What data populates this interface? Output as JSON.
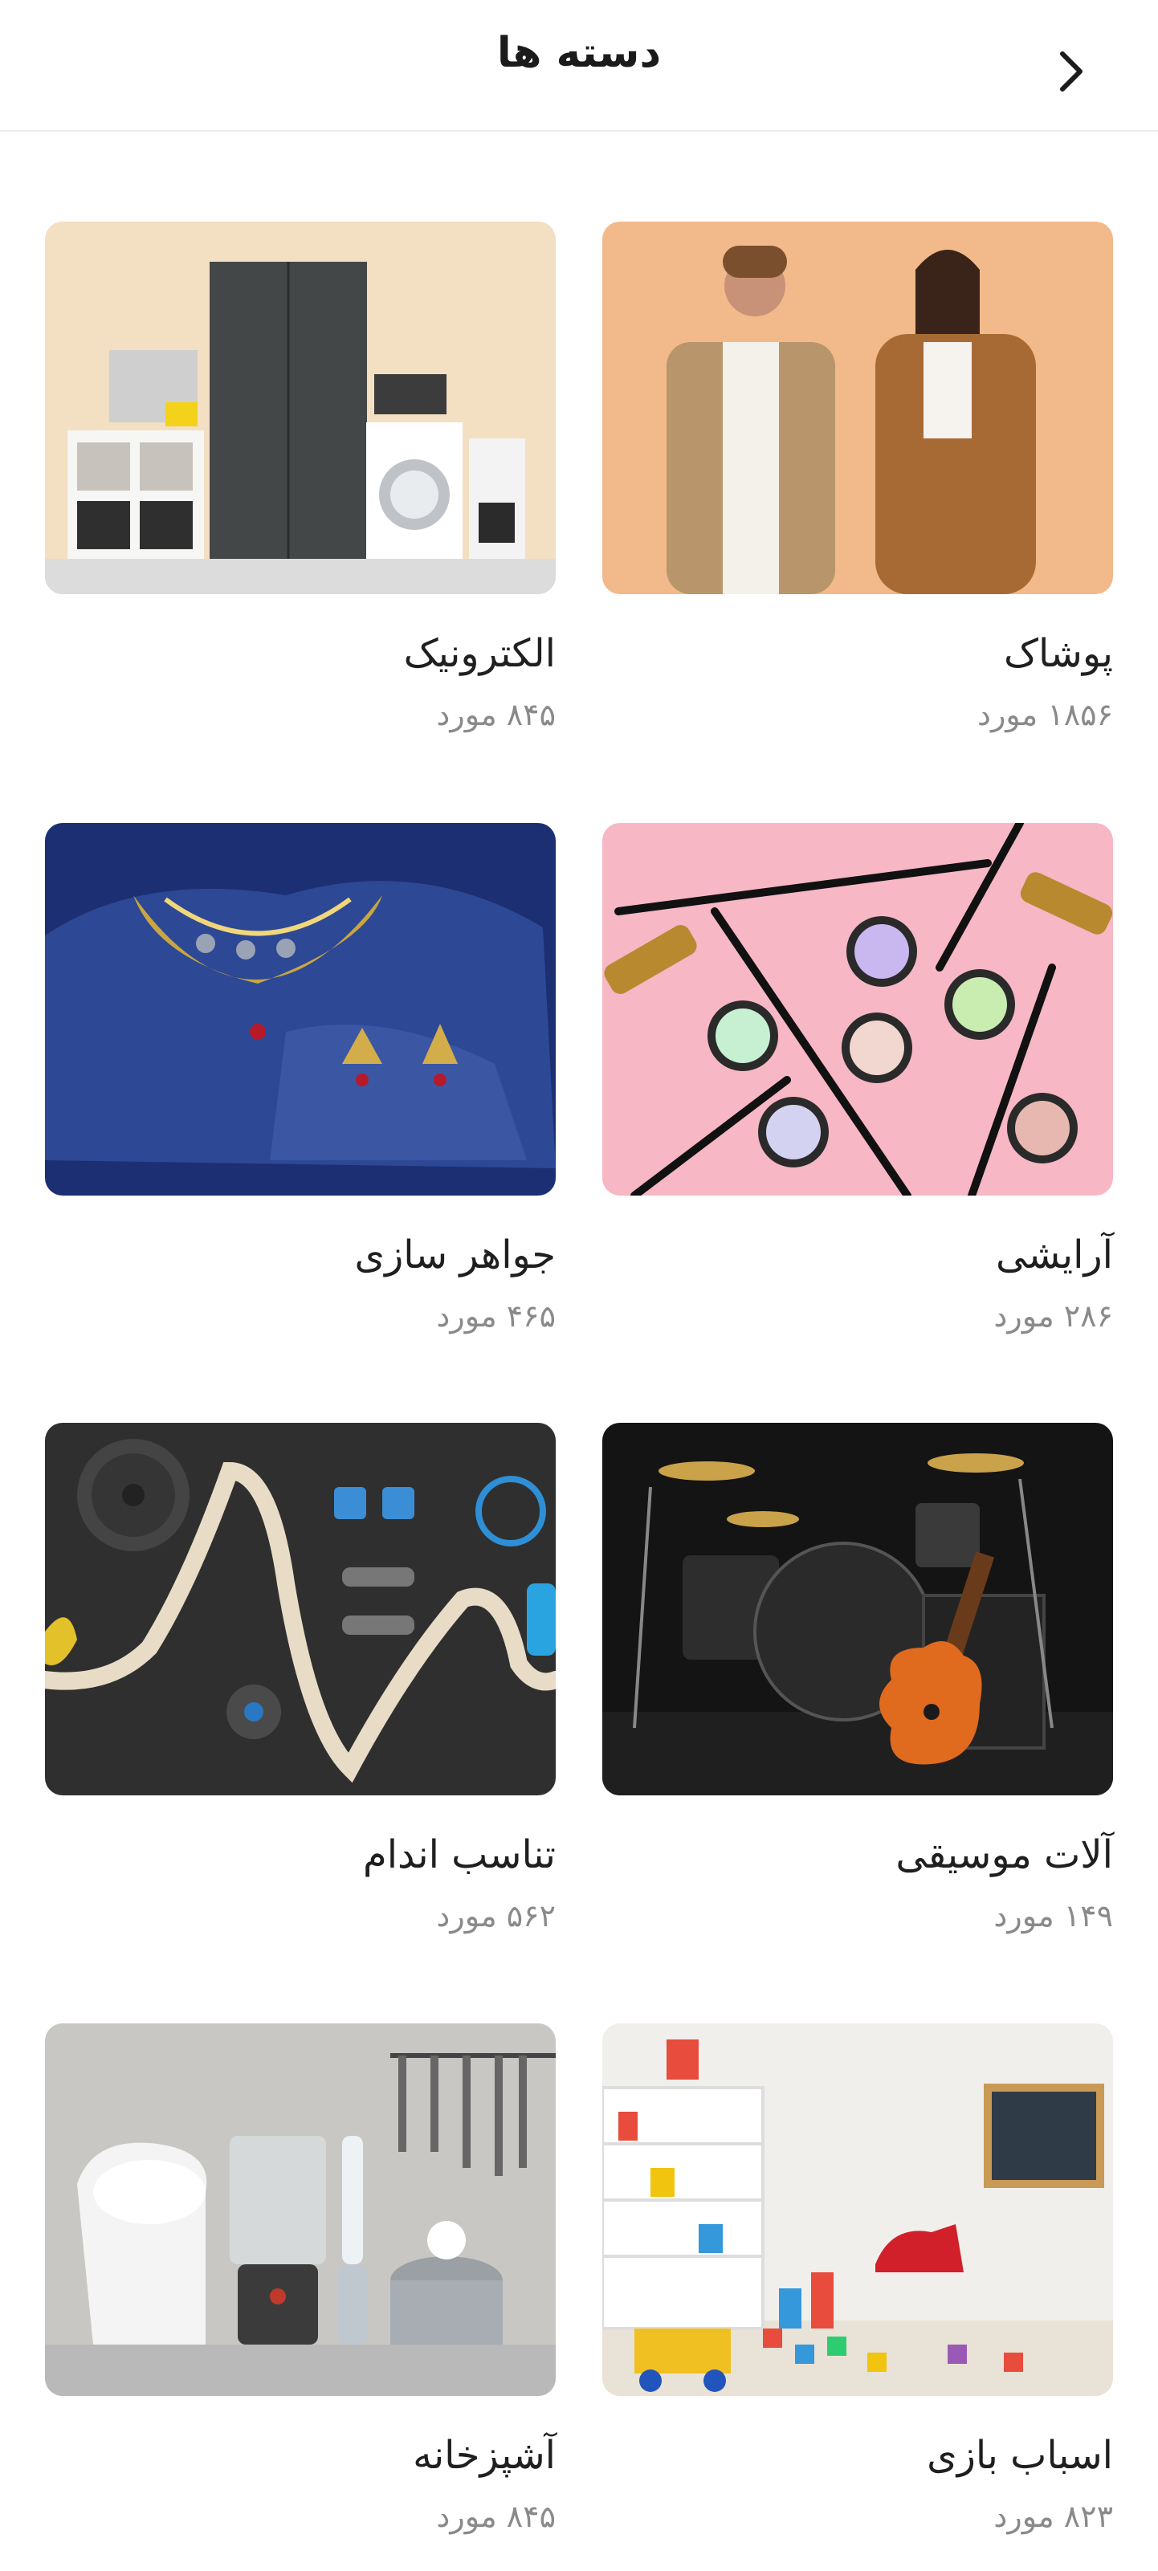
{
  "header": {
    "title": "دسته ها",
    "back_icon": "chevron-right-icon"
  },
  "categories": [
    {
      "label": "پوشاک",
      "count": "۱۸۵۶ مورد",
      "icon": "clothing-image"
    },
    {
      "label": "الکترونیک",
      "count": "۸۴۵ مورد",
      "icon": "electronics-image"
    },
    {
      "label": "آرایشی",
      "count": "۲۸۶ مورد",
      "icon": "cosmetics-image"
    },
    {
      "label": "جواهر سازی",
      "count": "۴۶۵ مورد",
      "icon": "jewelry-image"
    },
    {
      "label": "آلات موسیقی",
      "count": "۱۴۹ مورد",
      "icon": "music-instruments-image"
    },
    {
      "label": "تناسب اندام",
      "count": "۵۶۲ مورد",
      "icon": "fitness-image"
    },
    {
      "label": "اسباب بازی",
      "count": "۸۲۳ مورد",
      "icon": "toys-image"
    },
    {
      "label": "آشپزخانه",
      "count": "۸۴۵ مورد",
      "icon": "kitchen-image"
    }
  ]
}
